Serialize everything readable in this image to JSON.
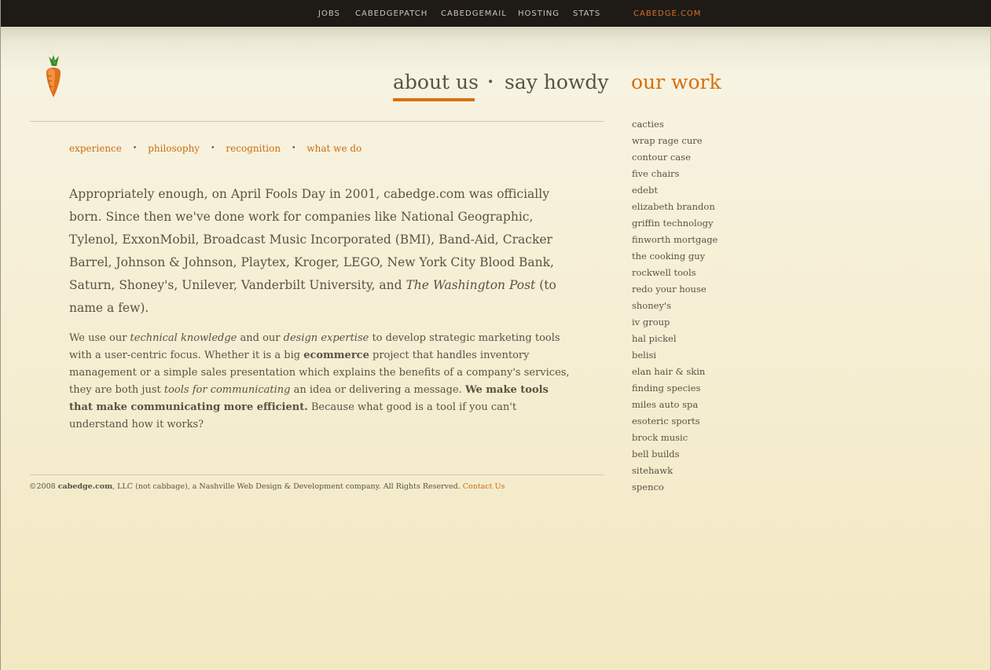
{
  "topnav": {
    "links": [
      "JOBS",
      "CABEDGEPATCH",
      "CABEDGEMAIL",
      "HOSTING",
      "STATS"
    ],
    "brand": "CABEDGE.COM"
  },
  "mainnav": {
    "about": "about us",
    "howdy": "say howdy",
    "work": "our work",
    "separator": "•"
  },
  "subnav": {
    "items": [
      "experience",
      "philosophy",
      "recognition",
      "what we do"
    ],
    "separator": "•"
  },
  "intro": {
    "p1": "Appropriately enough, on April Fools Day in 2001, cabedge.com was officially born. Since then we've done work for companies like National Geographic, Tylenol, ExxonMobil, Broadcast Music Incorporated (BMI), Band-Aid, Cracker Barrel, Johnson & Johnson, Playtex, Kroger, LEGO, New York City Blood Bank, Saturn, Shoney's, Unilever, Vanderbilt University, and ",
    "p1_em": "The Washington Post",
    "p1_end": " (to name a few)."
  },
  "body": {
    "t1": "We use our ",
    "e1": "technical knowledge",
    "t2": " and our ",
    "e2": "design expertise",
    "t3": " to develop strategic marketing tools with a user-centric focus. Whether it is a big ",
    "b1": "ecommerce",
    "t4": " project that handles inventory management or a simple sales presentation which explains the benefits of a company's services, they are both just ",
    "e3": "tools for communicating",
    "t5": " an idea or delivering a message. ",
    "b2": "We make tools that make communicating more efficient.",
    "t6": " Because what good is a tool if you can't understand how it works?"
  },
  "footer": {
    "prefix": "©2008 ",
    "company": "cabedge.com",
    "text": ", LLC (not cabbage), a Nashville Web Design & Development company. All Rights Reserved. ",
    "contact": "Contact Us"
  },
  "work": {
    "items": [
      "cacties",
      "wrap rage cure",
      "contour case",
      "five chairs",
      "edebt",
      "elizabeth brandon",
      "griffin technology",
      "finworth mortgage",
      "the cooking guy",
      "rockwell tools",
      "redo your house",
      "shoney's",
      "iv group",
      "hal pickel",
      "belisi",
      "elan hair & skin",
      "finding species",
      "miles auto spa",
      "esoteric sports",
      "brock music",
      "bell builds",
      "sitehawk",
      "spenco"
    ]
  },
  "colors": {
    "accent": "#d5710f",
    "topbar": "#1e1b17",
    "text": "#5a5244"
  },
  "icons": {
    "logo": "carrot-icon"
  }
}
